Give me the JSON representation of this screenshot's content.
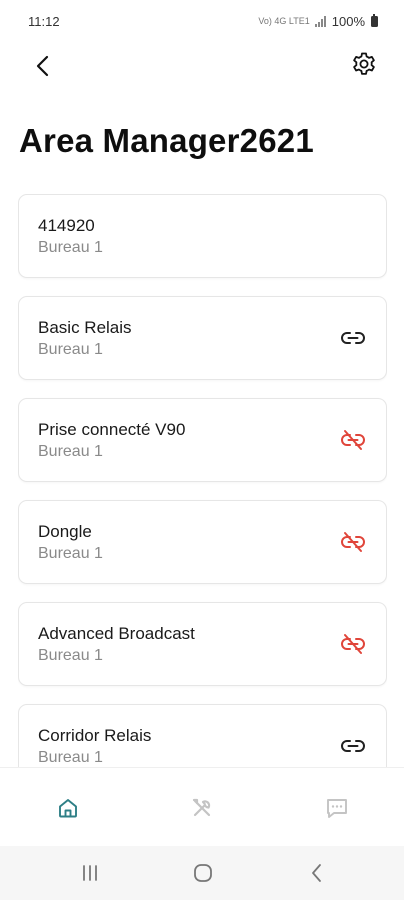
{
  "status_bar": {
    "time": "11:12",
    "signal_text": "Vo) 4G LTE1",
    "battery": "100%"
  },
  "header": {
    "title": "Area Manager2621"
  },
  "devices": [
    {
      "name": "414920",
      "location": "Bureau 1",
      "link_status": "none"
    },
    {
      "name": "Basic Relais",
      "location": "Bureau 1",
      "link_status": "linked"
    },
    {
      "name": "Prise connecté V90",
      "location": "Bureau 1",
      "link_status": "unlinked"
    },
    {
      "name": "Dongle",
      "location": "Bureau 1",
      "link_status": "unlinked"
    },
    {
      "name": "Advanced Broadcast",
      "location": "Bureau 1",
      "link_status": "unlinked"
    },
    {
      "name": "Corridor Relais",
      "location": "Bureau 1",
      "link_status": "linked"
    }
  ],
  "bottom_nav": {
    "tabs": [
      {
        "icon": "home-icon",
        "active": true
      },
      {
        "icon": "tools-icon",
        "active": false
      },
      {
        "icon": "chat-icon",
        "active": false
      }
    ]
  },
  "colors": {
    "active_tab": "#2e7f86",
    "inactive_tab": "#c4c4c4",
    "linked_icon": "#222222",
    "unlinked_icon": "#e0453a"
  }
}
